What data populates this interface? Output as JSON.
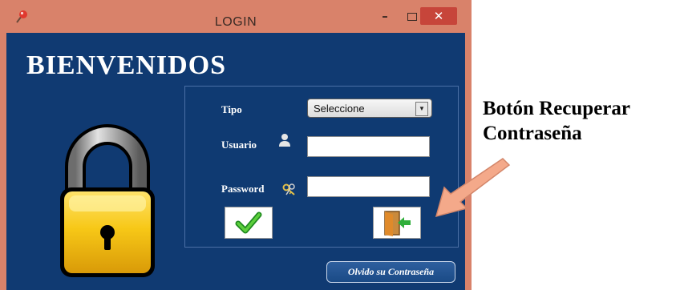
{
  "window": {
    "title": "LOGIN",
    "controls": {
      "minimize": "–",
      "close": "✕"
    }
  },
  "welcome": "BIENVENIDOS",
  "form": {
    "tipo_label": "Tipo",
    "tipo_value": "Seleccione",
    "usuario_label": "Usuario",
    "usuario_value": "",
    "password_label": "Password",
    "password_value": ""
  },
  "forgot_button": "Olvido su Contraseña",
  "annotation": {
    "line1": "Botón Recuperar",
    "line2": "Contraseña"
  },
  "colors": {
    "frame": "#d9826a",
    "panel": "#103a72",
    "close": "#c7453a",
    "lock_gold": "#f2c31a",
    "arrow": "#f4a98a"
  },
  "icons": [
    "pin-icon",
    "padlock-icon",
    "user-icon",
    "key-icon",
    "checkmark-icon",
    "exit-door-icon",
    "chevron-down-icon",
    "callout-arrow"
  ]
}
